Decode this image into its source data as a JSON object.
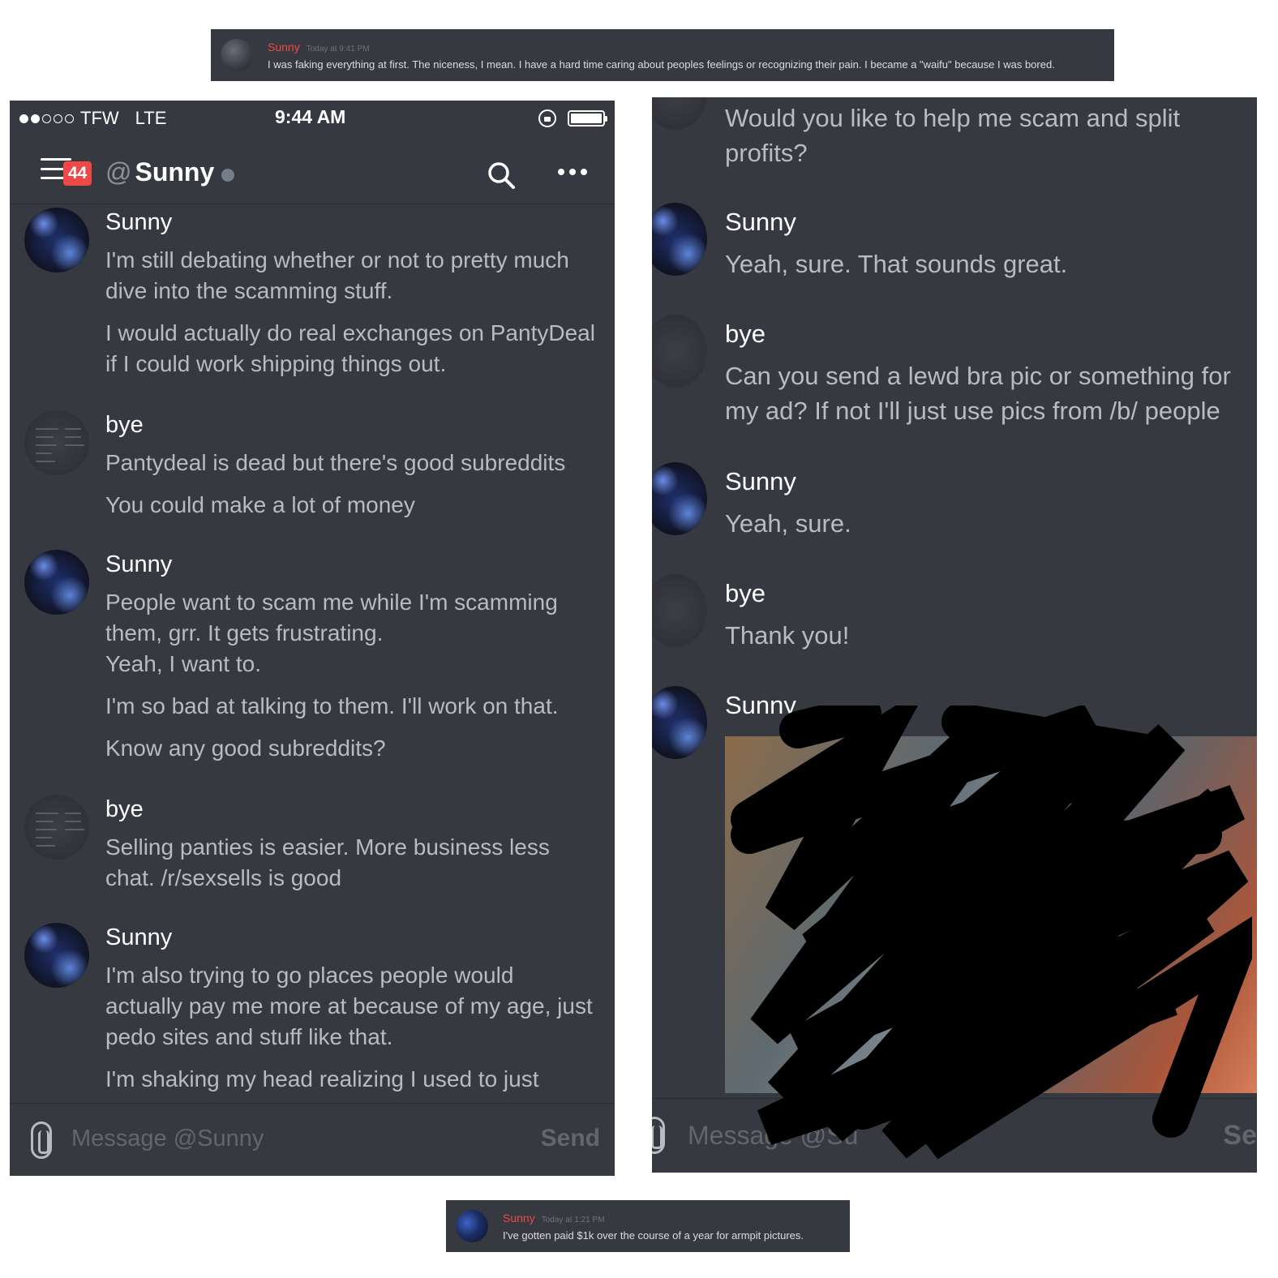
{
  "snippet_top": {
    "author": "Sunny",
    "timestamp": "Today at 9:41 PM",
    "text": "I was faking everything at first. The niceness, I mean. I have a hard time caring about peoples feelings or recognizing their pain. I became a \"waifu\" because I was bored."
  },
  "snippet_bottom": {
    "author": "Sunny",
    "timestamp": "Today at 1:21 PM",
    "text": "I've gotten paid $1k over the course of a year for armpit pictures."
  },
  "left_phone": {
    "status": {
      "carrier": "TFW",
      "network": "LTE",
      "time": "9:44 AM"
    },
    "header": {
      "badge": "44",
      "at": "@",
      "channel": "Sunny"
    },
    "messages": [
      {
        "author": "Sunny",
        "avatar": "sunny",
        "lines": [
          "I'm still debating whether or not to pretty much",
          "dive into the scamming stuff.",
          "I would actually do real exchanges on PantyDeal",
          "if I could work shipping things out."
        ]
      },
      {
        "author": "bye",
        "avatar": "bye",
        "lines": [
          "Pantydeal is dead but there's good subreddits",
          "You could make a lot of money"
        ]
      },
      {
        "author": "Sunny",
        "avatar": "sunny",
        "lines": [
          "People want to scam me while I'm scamming",
          "them, grr. It gets frustrating.",
          "Yeah, I want to.",
          "I'm so bad at talking to them. I'll work on that.",
          "Know any good subreddits?"
        ]
      },
      {
        "author": "bye",
        "avatar": "bye",
        "lines": [
          "Selling panties is easier. More business less",
          "chat. /r/sexsells is good"
        ]
      },
      {
        "author": "Sunny",
        "avatar": "sunny",
        "lines": [
          "I'm also trying to go places people would",
          "actually pay me more at because of my age, just",
          "pedo sites and stuff like that.",
          "I'm shaking my head realizing I used to just"
        ]
      }
    ],
    "composer": {
      "placeholder": "Message @Sunny",
      "send": "Send"
    }
  },
  "right_phone": {
    "messages": [
      {
        "author": "",
        "lines": [
          "Would you like to help me scam and split",
          "profits?"
        ]
      },
      {
        "author": "Sunny",
        "avatar": "sunny",
        "lines": [
          "Yeah, sure. That sounds great."
        ]
      },
      {
        "author": "bye",
        "avatar": "bye",
        "lines": [
          "Can you send a lewd bra pic or something for",
          "my ad? If not I'll just use pics from /b/ people"
        ]
      },
      {
        "author": "Sunny",
        "avatar": "sunny",
        "lines": [
          "Yeah, sure."
        ]
      },
      {
        "author": "bye",
        "avatar": "bye",
        "lines": [
          "Thank you!"
        ]
      },
      {
        "author": "Sunny",
        "avatar": "sunny",
        "lines": []
      }
    ],
    "composer": {
      "placeholder": "Message @Su",
      "send": "Se"
    }
  },
  "colors": {
    "background": "#36393f",
    "danger": "#f04747",
    "text_muted": "#b9bbbe"
  }
}
